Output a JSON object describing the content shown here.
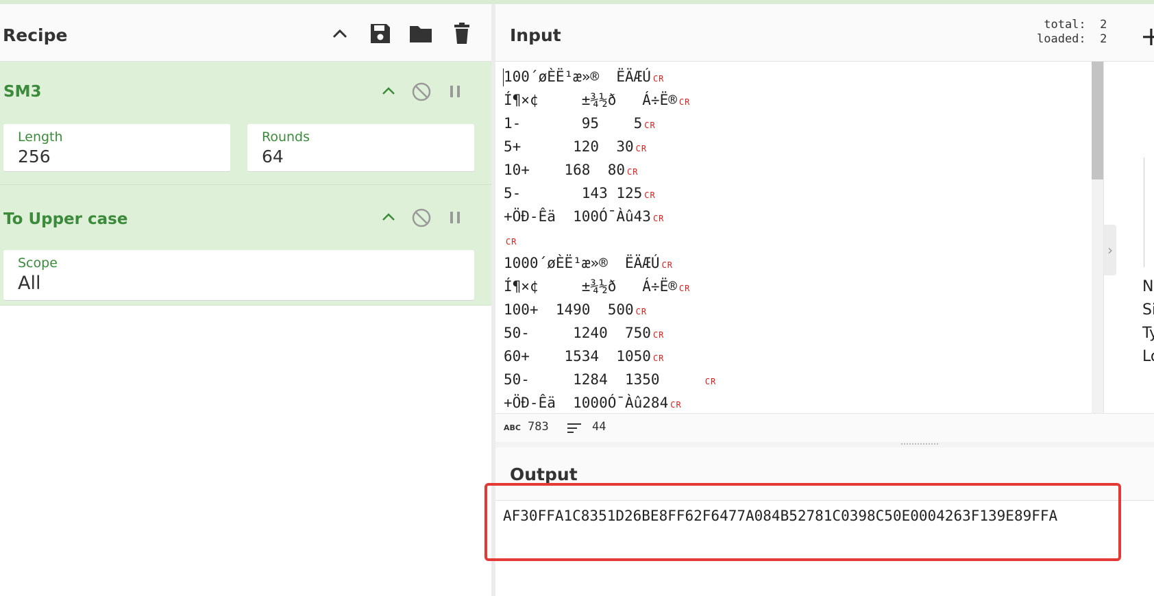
{
  "recipe": {
    "title": "Recipe",
    "header_icons": [
      "chevron-up-icon",
      "save-icon",
      "folder-icon",
      "trash-icon"
    ],
    "operations": [
      {
        "name": "SM3",
        "args": [
          {
            "label": "Length",
            "value": "256"
          },
          {
            "label": "Rounds",
            "value": "64"
          }
        ]
      },
      {
        "name": "To Upper case",
        "args": [
          {
            "label": "Scope",
            "value": "All"
          }
        ]
      }
    ]
  },
  "input": {
    "title": "Input",
    "total_label": "total:",
    "total_value": "2",
    "loaded_label": "loaded:",
    "loaded_value": "2",
    "lines": [
      "100´øÈË¹æ»®  ËÄÆÚ",
      "Í¶×¢     ±¾½ð   Á÷Ë®",
      "1-       95    5",
      "5+      120  30",
      "10+    168  80",
      "5-       143 125",
      "+ÖÐ-Êä  100Ó¯Àû43",
      "",
      "1000´øÈË¹æ»®  ËÄÆÚ",
      "Í¶×¢     ±¾½ð   Á÷Ë®",
      "100+  1490  500",
      "50-     1240  750",
      "60+    1534  1050",
      "50-     1284  1350     ",
      "+ÖÐ-Êä  1000Ó¯Àû284"
    ],
    "cr_marker": "CR",
    "side_labels": [
      "N",
      "Si",
      "Ty",
      "Lo"
    ]
  },
  "status": {
    "abc_label": "ABC",
    "char_count": "783",
    "line_count": "44"
  },
  "output": {
    "title": "Output",
    "value": "AF30FFA1C8351D26BE8FF62F6477A084B52781C0398C50E0004263F139E89FFA"
  },
  "colors": {
    "operation_bg": "#dff0d8",
    "operation_title": "#3c8a3c",
    "cr_marker": "#d92020",
    "highlight_border": "#e53935"
  }
}
